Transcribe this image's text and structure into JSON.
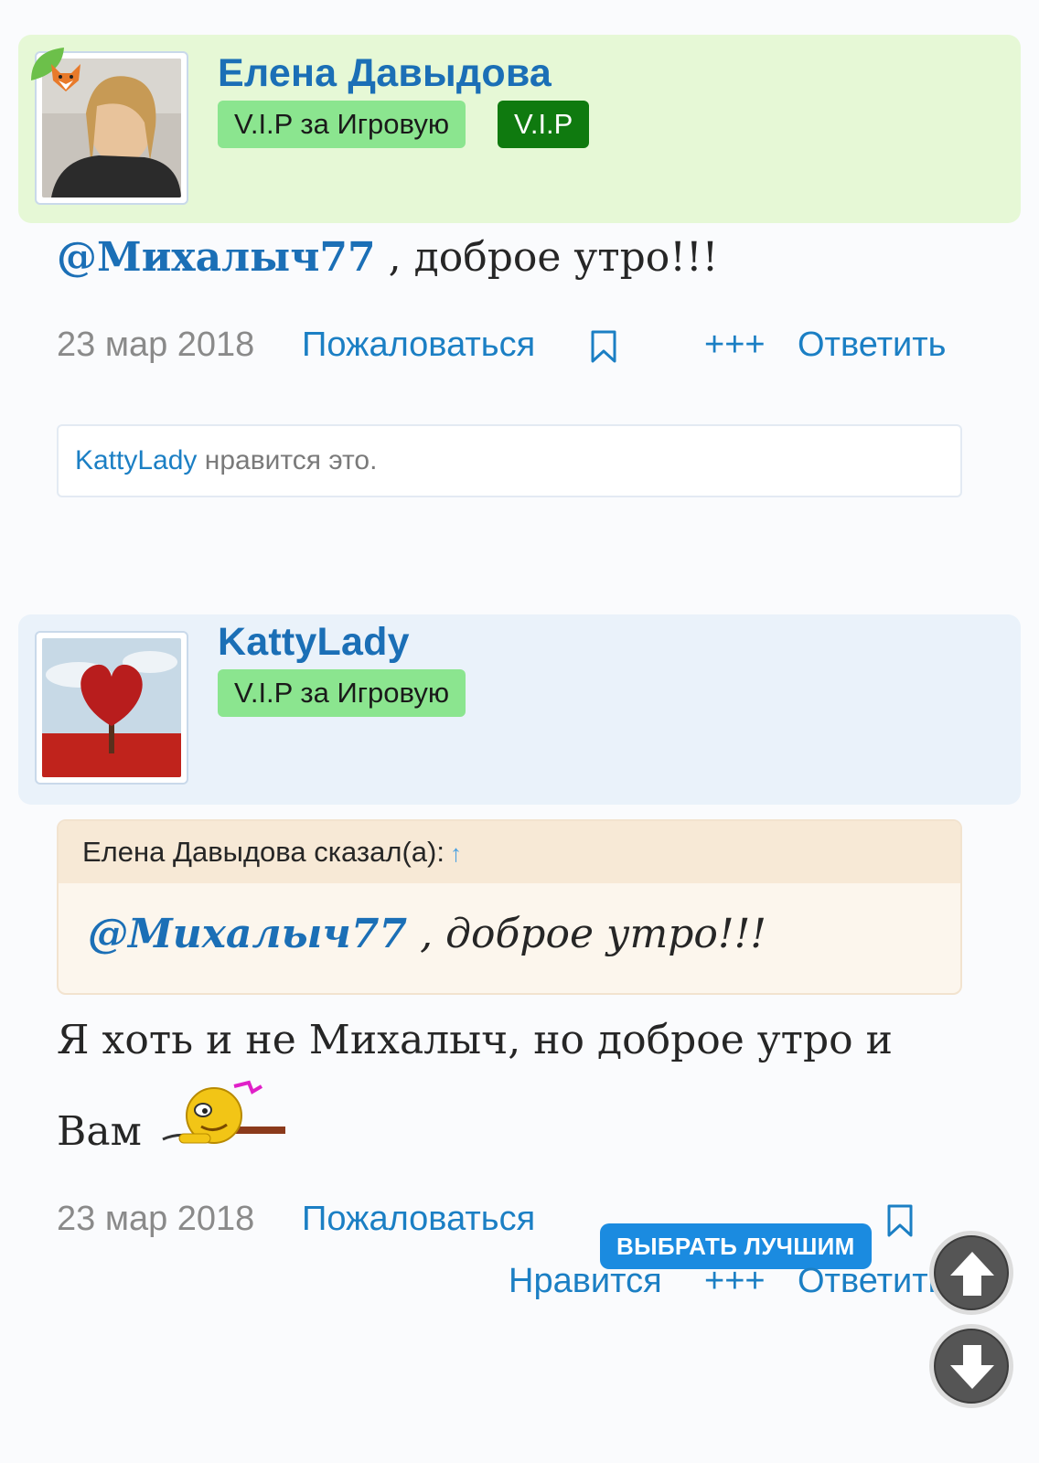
{
  "posts": [
    {
      "author": "Елена Давыдова",
      "badges": [
        "V.I.P за Игровую",
        "V.I.P"
      ],
      "message": {
        "mention": "@Михалыч77",
        "text": " , доброе утро!!!"
      },
      "date": "23 мар 2018",
      "actions": {
        "report": "Пожаловаться",
        "plus": "+++",
        "reply": "Ответить"
      },
      "likes": {
        "user": "KattyLady",
        "text": " нравится это."
      }
    },
    {
      "author": "KattyLady",
      "badges": [
        "V.I.P за Игровую"
      ],
      "quote": {
        "header": "Елена Давыдова сказал(а):",
        "arrow": "↑",
        "mention": "@Михалыч77",
        "text": " , доброе утро!!!"
      },
      "message": {
        "line1": "Я хоть и не Михалыч, но доброе утро и",
        "line2": "Вам"
      },
      "date": "23 мар 2018",
      "actions": {
        "report": "Пожаловаться",
        "best": "ВЫБРАТЬ ЛУЧШИМ",
        "like": "Нравится",
        "plus": "+++",
        "reply": "Ответить"
      }
    }
  ],
  "icons": {
    "bookmark": "bookmark-icon",
    "scroll_up": "arrow-up-icon",
    "scroll_down": "arrow-down-icon",
    "emoji": "smiley-emoji"
  },
  "colors": {
    "link": "#1b7fc4",
    "author": "#1b6fb6",
    "vip_light": "#8be58f",
    "vip_dark": "#0f7a0f",
    "best_button": "#1b8be0"
  }
}
